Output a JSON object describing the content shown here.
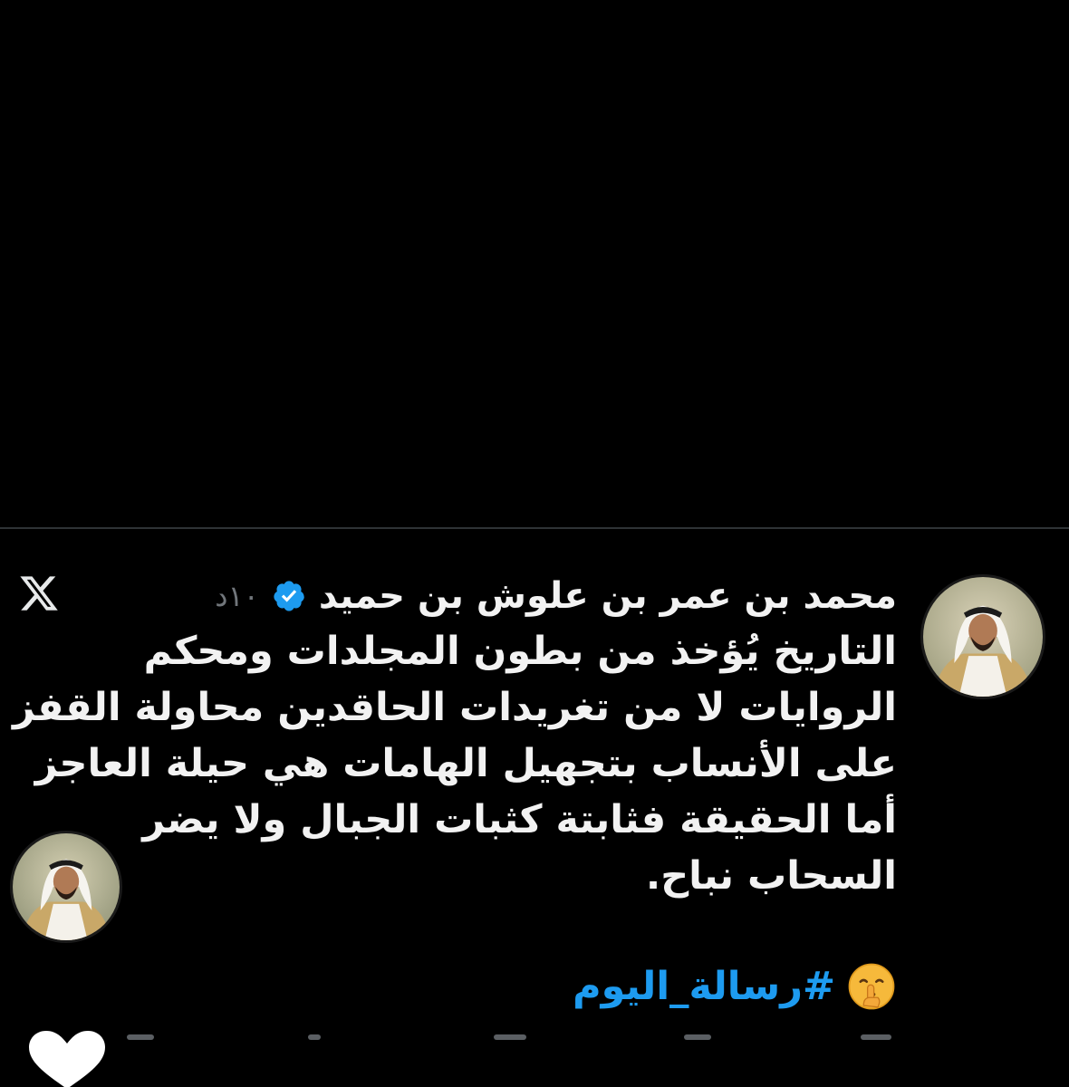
{
  "tweet": {
    "display_name": "محمد بن عمر بن علوش بن حميد",
    "time_ago": "١٠د",
    "text_lines": [
      "التاريخ يُؤخذ من بطون المجلدات ومحكم",
      "الروايات لا من تغريدات الحاقدين محاولة القفز",
      "على الأنساب بتجهيل الهامات هي حيلة العاجز",
      "أما الحقيقة فثابتة كثبات الجبال ولا يضر",
      "السحاب نباح."
    ],
    "hashtag": "#رسالة_اليوم",
    "emoji": "shushing-face-icon"
  },
  "icons": {
    "verified": "verified-badge-icon",
    "platform": "x-logo-icon",
    "like": "heart-icon"
  },
  "colors": {
    "background": "#000000",
    "text": "#f2f2f2",
    "muted": "#71767b",
    "link": "#1d9bf0",
    "verified": "#1d9bf0"
  }
}
